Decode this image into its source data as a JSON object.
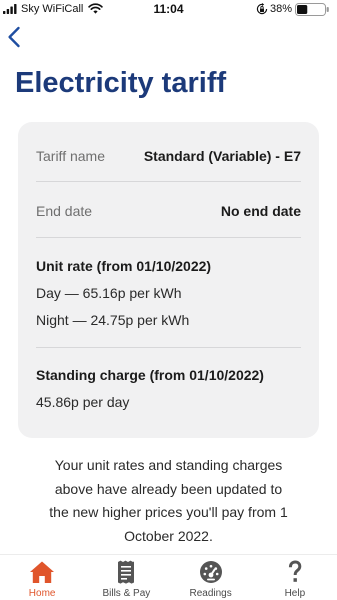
{
  "status_bar": {
    "carrier": "Sky WiFiCall",
    "time": "11:04",
    "battery_percent": "38%",
    "battery_level": 0.38,
    "icons": [
      "signal-icon",
      "wifi-icon",
      "orientation-lock-icon",
      "battery-icon"
    ]
  },
  "nav": {
    "back_icon": "chevron-left-icon"
  },
  "page": {
    "title": "Electricity tariff"
  },
  "tariff_card": {
    "rows": [
      {
        "label": "Tariff name",
        "value": "Standard (Variable) - E7"
      },
      {
        "label": "End date",
        "value": "No end date"
      }
    ],
    "unit_rate": {
      "heading": "Unit rate (from 01/10/2022)",
      "lines": [
        "Day — 65.16p per kWh",
        "Night — 24.75p per kWh"
      ]
    },
    "standing_charge": {
      "heading": "Standing charge (from 01/10/2022)",
      "lines": [
        "45.86p per day"
      ]
    }
  },
  "notice": {
    "text": "Your unit rates and standing charges above have already been updated to the new higher prices you'll pay from 1 October 2022."
  },
  "tab_bar": {
    "tabs": [
      {
        "label": "Home",
        "icon": "home-icon",
        "active": true
      },
      {
        "label": "Bills & Pay",
        "icon": "receipt-icon",
        "active": false
      },
      {
        "label": "Readings",
        "icon": "gauge-icon",
        "active": false
      },
      {
        "label": "Help",
        "icon": "help-icon",
        "active": false
      }
    ]
  },
  "colors": {
    "title": "#1c3a7a",
    "accent": "#e0552b",
    "back_chevron": "#1f4ea1",
    "card_bg": "#f1f1f2",
    "icon": "#555555"
  }
}
